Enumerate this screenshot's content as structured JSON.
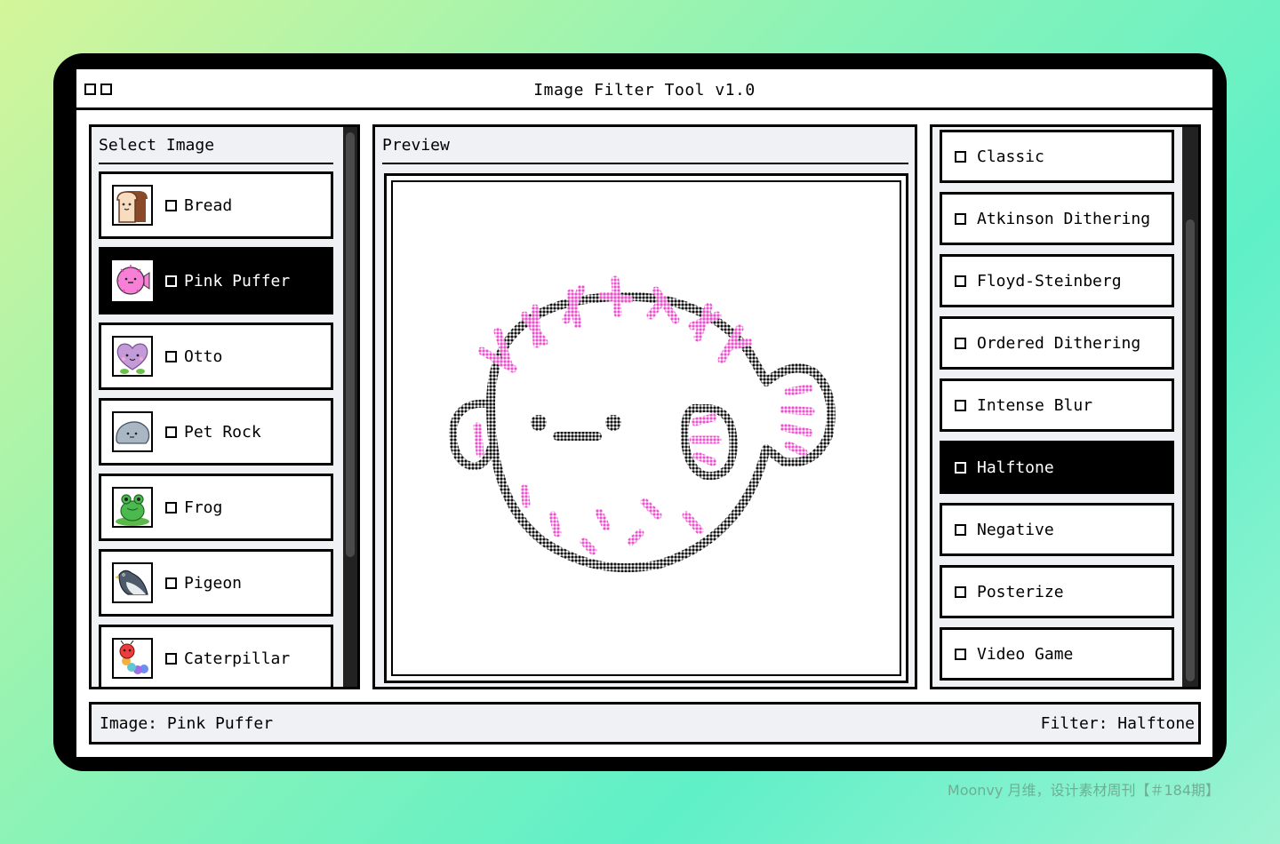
{
  "window": {
    "title": "Image Filter Tool v1.0"
  },
  "left_panel": {
    "heading": "Select Image",
    "items": [
      {
        "label": "Bread",
        "icon": "bread-icon",
        "selected": false
      },
      {
        "label": "Pink Puffer",
        "icon": "pufferfish-icon",
        "selected": true
      },
      {
        "label": "Otto",
        "icon": "heart-creature-icon",
        "selected": false
      },
      {
        "label": "Pet Rock",
        "icon": "rock-icon",
        "selected": false
      },
      {
        "label": "Frog",
        "icon": "frog-icon",
        "selected": false
      },
      {
        "label": "Pigeon",
        "icon": "pigeon-icon",
        "selected": false
      },
      {
        "label": "Caterpillar",
        "icon": "caterpillar-icon",
        "selected": false
      }
    ]
  },
  "preview": {
    "heading": "Preview",
    "image": "pufferfish-halftone-image"
  },
  "filters": {
    "items": [
      {
        "label": "Classic",
        "selected": false
      },
      {
        "label": "Atkinson Dithering",
        "selected": false
      },
      {
        "label": "Floyd-Steinberg",
        "selected": false
      },
      {
        "label": "Ordered Dithering",
        "selected": false
      },
      {
        "label": "Intense Blur",
        "selected": false
      },
      {
        "label": "Halftone",
        "selected": true
      },
      {
        "label": "Negative",
        "selected": false
      },
      {
        "label": "Posterize",
        "selected": false
      },
      {
        "label": "Video Game",
        "selected": false
      }
    ]
  },
  "status": {
    "image_text": "Image: Pink Puffer",
    "filter_text": "Filter: Halftone"
  },
  "watermark": "Moonvy 月维，设计素材周刊【＃184期】",
  "colors": {
    "accent_pink": "#f050d0",
    "panel_bg": "#f0f1f5",
    "selected_bg": "#000000"
  }
}
